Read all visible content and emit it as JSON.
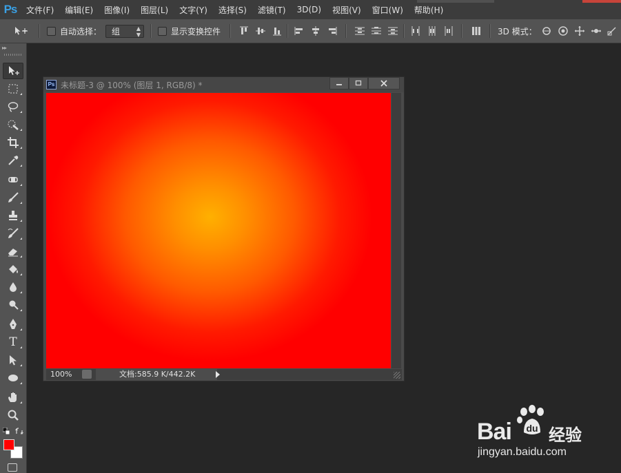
{
  "app": {
    "logo": "Ps"
  },
  "menu": [
    "文件(F)",
    "编辑(E)",
    "图像(I)",
    "图层(L)",
    "文字(Y)",
    "选择(S)",
    "滤镜(T)",
    "3D(D)",
    "视图(V)",
    "窗口(W)",
    "帮助(H)"
  ],
  "options": {
    "auto_select_label": "自动选择：",
    "auto_select_checked": false,
    "group_value": "组",
    "show_transform_label": "显示变换控件",
    "show_transform_checked": false,
    "mode_3d_label": "3D 模式："
  },
  "toolbox": {
    "tools": [
      "move-tool",
      "marquee-tool",
      "lasso-tool",
      "quick-select-tool",
      "crop-tool",
      "eyedropper-tool",
      "healing-brush-tool",
      "brush-tool",
      "clone-stamp-tool",
      "history-brush-tool",
      "eraser-tool",
      "paint-bucket-tool",
      "blur-tool",
      "dodge-tool",
      "pen-tool",
      "type-tool",
      "path-selection-tool",
      "ellipse-tool",
      "hand-tool",
      "zoom-tool"
    ],
    "active_tool": "move-tool",
    "foreground_color": "#ff0000",
    "background_color": "#ffffff",
    "type_tool_glyph": "T"
  },
  "document": {
    "title": "未标题-3 @ 100% (图层 1, RGB/8) *",
    "ps_badge": "Ps",
    "zoom": "100%",
    "doc_info": "文档:585.9 K/442.2K",
    "gradient": {
      "type": "radial",
      "center_color": "#ffb000",
      "edge_color": "#ff0000"
    }
  },
  "watermark": {
    "brand": "Bai",
    "brand_suffix": "经验",
    "url": "jingyan.baidu.com"
  }
}
